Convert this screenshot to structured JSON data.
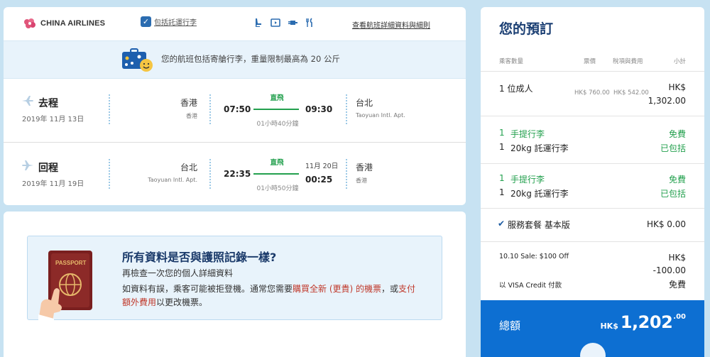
{
  "flight": {
    "airline": "CHINA AIRLINES",
    "baggage_included_link": "包括託運行李",
    "details_link": "查看航班詳細資料與細則",
    "baggage_banner": "您的航班包括寄艙行李，重量限制最高為 20 公斤",
    "outbound": {
      "direction": "去程",
      "date": "2019年 11月 13日",
      "from_city": "香港",
      "from_airport": "香港",
      "depart": "07:50",
      "nonstop": "直飛",
      "duration": "01小時40分鐘",
      "arrive": "09:30",
      "to_city": "台北",
      "to_airport": "Taoyuan Intl. Apt."
    },
    "return": {
      "direction": "回程",
      "date": "2019年 11月 19日",
      "from_city": "台北",
      "from_airport": "Taoyuan Intl. Apt.",
      "depart": "22:35",
      "nonstop": "直飛",
      "duration": "01小時50分鐘",
      "arrive_date": "11月 20日",
      "arrive": "00:25",
      "to_city": "香港",
      "to_airport": "香港"
    }
  },
  "passport": {
    "title": "所有資料是否與護照記錄一樣?",
    "subtitle": "再檢查一次您的個人詳細資料",
    "body_1": "如資料有誤，乘客可能被拒登機。通常您需要",
    "body_red_1": "購買全新 (更貴) 的機票",
    "body_2": "，或",
    "body_red_2": "支付額外費用",
    "body_3": "以更改機票。",
    "passport_word": "PASSPORT"
  },
  "booking": {
    "title": "您的預訂",
    "headers": {
      "passengers": "乘客數量",
      "fare": "票價",
      "taxes": "稅項與費用",
      "subtotal": "小計"
    },
    "adult_line": "1 位成人",
    "adult_fare": "HK$ 760.00",
    "adult_taxes": "HK$ 542.00",
    "adult_currency": "HK$",
    "adult_subtotal": "1,302.00",
    "out_bag": {
      "carry_qty": "1",
      "carry": "手提行李",
      "carry_price": "免費",
      "check_qty": "1",
      "check": "20kg 託運行李",
      "check_status": "已包括"
    },
    "ret_bag": {
      "carry_qty": "1",
      "carry": "手提行李",
      "carry_price": "免費",
      "check_qty": "1",
      "check": "20kg 託運行李",
      "check_status": "已包括"
    },
    "service_pkg": "服務套餐 基本版",
    "service_price": "HK$ 0.00",
    "sale_label": "10.10 Sale: $100 Off",
    "sale_currency": "HK$",
    "sale_amount": "-100.00",
    "visa_label": "以 VISA Credit 付款",
    "visa_price": "免費",
    "total_label": "總額",
    "total_currency": "HK$",
    "total_amount": "1,202",
    "total_decimals": ".00"
  }
}
